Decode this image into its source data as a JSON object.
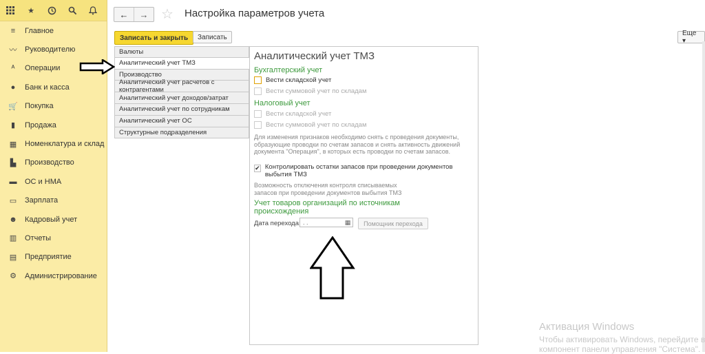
{
  "sidebar": {
    "items": [
      {
        "label": "Главное",
        "icon": "menu-icon",
        "glyph": "≡"
      },
      {
        "label": "Руководителю",
        "icon": "trend-icon",
        "glyph": "〰"
      },
      {
        "label": "Операции",
        "icon": "operations-icon",
        "glyph": "ᴬ"
      },
      {
        "label": "Банк и касса",
        "icon": "bank-icon",
        "glyph": "●"
      },
      {
        "label": "Покупка",
        "icon": "cart-icon",
        "glyph": "🛒"
      },
      {
        "label": "Продажа",
        "icon": "bag-icon",
        "glyph": "▮"
      },
      {
        "label": "Номенклатура и склад",
        "icon": "grid-icon",
        "glyph": "▦"
      },
      {
        "label": "Производство",
        "icon": "factory-icon",
        "glyph": "▙"
      },
      {
        "label": "ОС и НМА",
        "icon": "truck-icon",
        "glyph": "▬"
      },
      {
        "label": "Зарплата",
        "icon": "cash-icon",
        "glyph": "▭"
      },
      {
        "label": "Кадровый учет",
        "icon": "people-icon",
        "glyph": "☻"
      },
      {
        "label": "Отчеты",
        "icon": "bar-chart-icon",
        "glyph": "▥"
      },
      {
        "label": "Предприятие",
        "icon": "building-icon",
        "glyph": "▤"
      },
      {
        "label": "Администрирование",
        "icon": "gear-icon",
        "glyph": "⚙"
      }
    ]
  },
  "header": {
    "title": "Настройка параметров учета",
    "back": "←",
    "forward": "→"
  },
  "toolbar": {
    "save_close": "Записать и закрыть",
    "save": "Записать",
    "more": "Еще ▾",
    "help": "?"
  },
  "tabs": [
    "Валюты",
    "Аналитический учет ТМЗ",
    "Производство",
    "Аналитический учет расчетов с контрагентами",
    "Аналитический учет доходов/затрат",
    "Аналитический учет по сотрудникам",
    "Аналитический учет ОС",
    "Структурные подразделения"
  ],
  "panel": {
    "heading": "Аналитический учет ТМЗ",
    "buh_title": "Бухгалтерский учет",
    "buh_cb1": "Вести складской учет",
    "buh_cb2": "Вести суммовой учет по складам",
    "tax_title": "Налоговый учет",
    "tax_cb1": "Вести складской учет",
    "tax_cb2": "Вести суммовой учет по складам",
    "note1": "Для изменения признаков необходимо снять с проведения документы, образующие проводки по счетам запасов и снять активность движений документа \"Операция\", в которых есть проводки по счетам запасов.",
    "control_cb": "Контролировать остатки запасов при проведении документов выбытия ТМЗ",
    "note2": "Возможность отключения контроля списываемых запасов при проведении документов выбытия ТМЗ",
    "sources_title": "Учет товаров организаций по источникам происхождения",
    "date_label": "Дата перехода:",
    "date_value": ". .",
    "helper_button": "Помощник перехода"
  },
  "watermark": {
    "line1": "Активация Windows",
    "line2": "Чтобы активировать Windows, перейдите в",
    "line3": "компонент панели управления \"Система\"."
  }
}
